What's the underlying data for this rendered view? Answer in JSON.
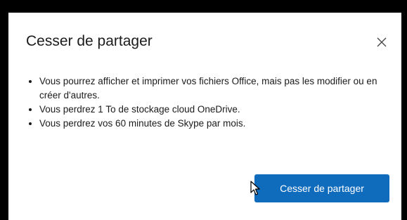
{
  "dialog": {
    "title": "Cesser de partager",
    "close_icon": "close-icon",
    "bullets": [
      "Vous pourrez afficher et imprimer vos fichiers Office, mais pas les modifier ou en créer d'autres.",
      "Vous perdrez 1 To de stockage cloud OneDrive.",
      "Vous perdrez vos 60 minutes de Skype par mois."
    ],
    "primary_button_label": "Cesser de partager"
  },
  "colors": {
    "backdrop": "#000000",
    "dialog_background": "#ffffff",
    "text": "#1b1b1b",
    "primary_button": "#0f6cbd",
    "primary_button_text": "#ffffff"
  }
}
